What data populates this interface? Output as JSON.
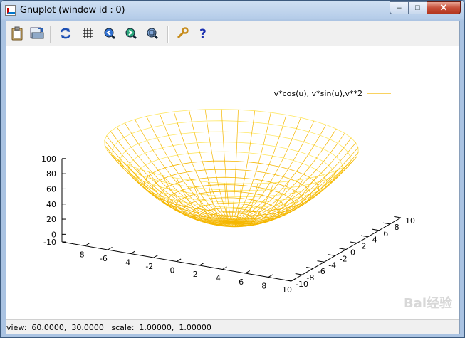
{
  "window": {
    "title": "Gnuplot (window id : 0)",
    "buttons": {
      "minimize": "–",
      "maximize": "□",
      "close": "✕"
    }
  },
  "toolbar": {
    "icons": [
      "clipboard-icon",
      "print-icon",
      "replot-icon",
      "grid-icon",
      "zoom-previous-icon",
      "zoom-next-icon",
      "unzoom-icon",
      "options-wrench-icon",
      "help-icon"
    ]
  },
  "status": {
    "text": "view:  60.0000,  30.0000   scale:  1.00000,  1.00000"
  },
  "watermark": "Bai经验",
  "colors": {
    "surface": "#f5b700",
    "surface_light": "#ffe866",
    "axes": "#000000"
  },
  "chart_data": {
    "type": "surface3d",
    "legend": "v*cos(u), v*sin(u),v**2",
    "parametric": {
      "x": "v*cos(u)",
      "y": "v*sin(u)",
      "z": "v**2"
    },
    "view": [
      60,
      30
    ],
    "scale": [
      1.0,
      1.0
    ],
    "x_ticks": [
      "-8",
      "-6",
      "-4",
      "-2",
      "0",
      "2",
      "4",
      "6",
      "8",
      "10"
    ],
    "y_ticks": [
      "-10",
      "-8",
      "-6",
      "-4",
      "-2",
      "0",
      "2",
      "4",
      "6",
      "8",
      "10"
    ],
    "z_ticks": [
      "-10",
      "0",
      "20",
      "40",
      "60",
      "80",
      "100"
    ],
    "xrange": [
      -10,
      10
    ],
    "yrange": [
      -10,
      10
    ],
    "zrange": [
      -10,
      100
    ]
  }
}
